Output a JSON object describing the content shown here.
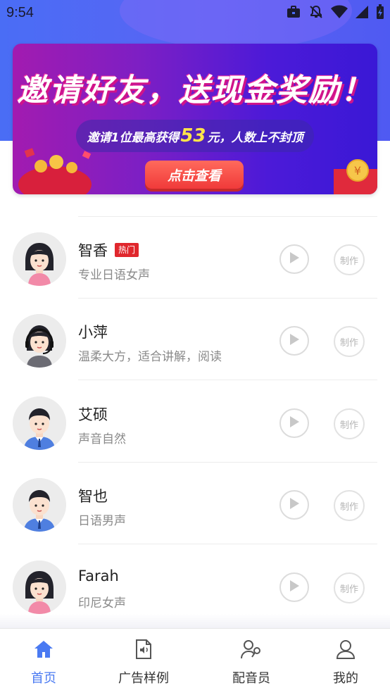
{
  "status_bar": {
    "time": "9:54",
    "icons": [
      "briefcase-icon",
      "notifications-off-icon",
      "wifi-icon",
      "cell-signal-icon",
      "battery-charging-icon"
    ]
  },
  "banner": {
    "title": "邀请好友，送现金奖励！",
    "subtitle_prefix": "邀请1位最高获得",
    "subtitle_amount": "53",
    "subtitle_suffix": "元，人数上不封顶",
    "cta_label": "点击查看"
  },
  "voices": [
    {
      "name": "智香",
      "badge": "热门",
      "desc": "专业日语女声",
      "avatar": "female"
    },
    {
      "name": "小萍",
      "badge": "",
      "desc": "温柔大方，适合讲解，阅读",
      "avatar": "headset"
    },
    {
      "name": "艾硕",
      "badge": "",
      "desc": "声音自然",
      "avatar": "male"
    },
    {
      "name": "智也",
      "badge": "",
      "desc": "日语男声",
      "avatar": "male"
    },
    {
      "name": "Farah",
      "badge": "",
      "desc": "印尼女声",
      "avatar": "female"
    }
  ],
  "make_label": "制作",
  "tabs": [
    {
      "label": "首页",
      "icon": "home-icon",
      "active": true
    },
    {
      "label": "广告样例",
      "icon": "audio-file-icon",
      "active": false
    },
    {
      "label": "配音员",
      "icon": "voice-actor-icon",
      "active": false
    },
    {
      "label": "我的",
      "icon": "profile-icon",
      "active": false
    }
  ],
  "colors": {
    "accent": "#4a7af2",
    "hot_badge": "#e0272d",
    "header": "#4a6df5"
  }
}
